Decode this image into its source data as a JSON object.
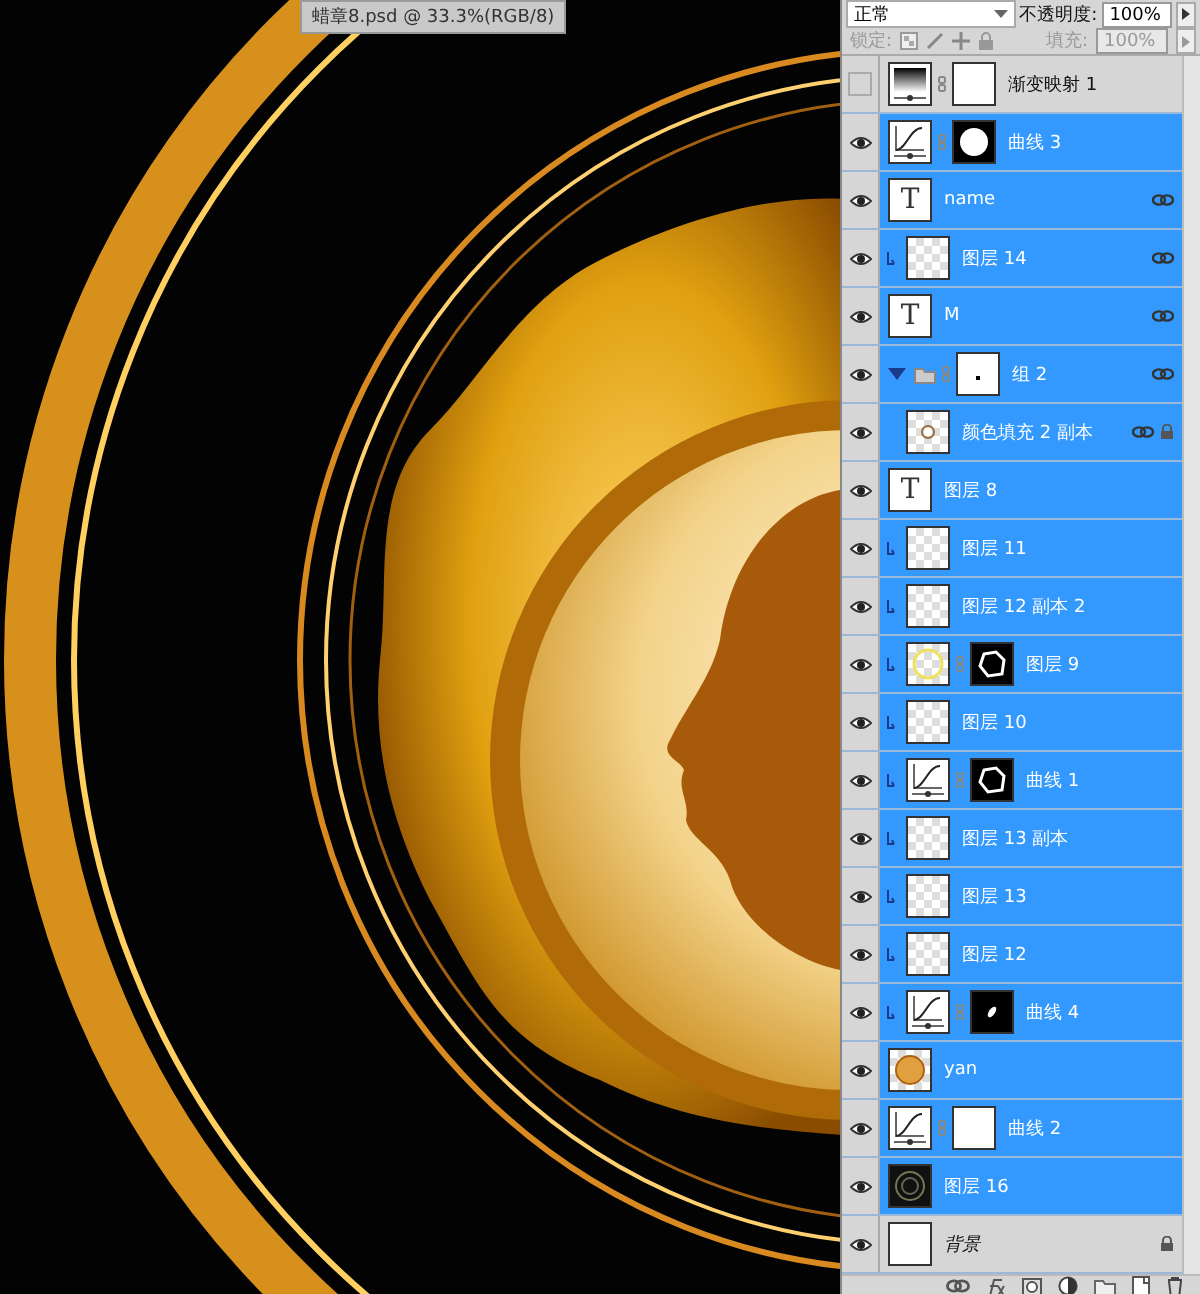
{
  "document_tab": {
    "title": "蜡章8.psd @ 33.3%(RGB/8)"
  },
  "layers_panel": {
    "blend_mode": "正常",
    "opacity_label": "不透明度:",
    "opacity": "100%",
    "lock_label": "锁定:",
    "fill_label": "填充:",
    "fill": "100%",
    "layers": [
      {
        "name": "渐变映射 1",
        "kind": "gradient",
        "visible": false,
        "selected": false,
        "clipped": false,
        "mask": {
          "kind": "plain"
        },
        "linked": false,
        "locked": false
      },
      {
        "name": "曲线 3",
        "kind": "curves",
        "visible": true,
        "selected": true,
        "clipped": false,
        "mask": {
          "kind": "circle"
        },
        "linked": false,
        "locked": false
      },
      {
        "name": "name",
        "kind": "text",
        "thumb_text": "T",
        "visible": true,
        "selected": true,
        "clipped": false,
        "linked": true,
        "locked": false
      },
      {
        "name": "图层 14",
        "kind": "pixel",
        "visible": true,
        "selected": true,
        "clipped": true,
        "linked": true,
        "locked": false
      },
      {
        "name": "M",
        "kind": "text",
        "thumb_text": "T",
        "visible": true,
        "selected": true,
        "clipped": false,
        "linked": true,
        "locked": false
      },
      {
        "name": "组 2",
        "kind": "group",
        "visible": true,
        "selected": true,
        "clipped": false,
        "mask": {
          "kind": "dot"
        },
        "linked": true,
        "locked": false,
        "expanded": true,
        "children": [
          {
            "name": "颜色填充 2 副本",
            "kind": "fill",
            "visible": true,
            "selected": true,
            "clipped": false,
            "linked": true,
            "locked": true
          }
        ]
      },
      {
        "name": "图层 8",
        "kind": "text",
        "thumb_text": "T",
        "visible": true,
        "selected": true,
        "clipped": false,
        "linked": false,
        "locked": false
      },
      {
        "name": "图层 11",
        "kind": "pixel",
        "visible": true,
        "selected": true,
        "clipped": true,
        "linked": false,
        "locked": false
      },
      {
        "name": "图层 12 副本 2",
        "kind": "pixel",
        "visible": true,
        "selected": true,
        "clipped": true,
        "linked": false,
        "locked": false
      },
      {
        "name": "图层 9",
        "kind": "ring",
        "visible": true,
        "selected": true,
        "clipped": true,
        "mask": {
          "kind": "outline"
        },
        "linked": false,
        "locked": false
      },
      {
        "name": "图层 10",
        "kind": "pixel",
        "visible": true,
        "selected": true,
        "clipped": true,
        "linked": false,
        "locked": false
      },
      {
        "name": "曲线 1",
        "kind": "curves",
        "visible": true,
        "selected": true,
        "clipped": true,
        "mask": {
          "kind": "outline"
        },
        "linked": false,
        "locked": false
      },
      {
        "name": "图层 13 副本",
        "kind": "pixel",
        "visible": true,
        "selected": true,
        "clipped": true,
        "linked": false,
        "locked": false
      },
      {
        "name": "图层 13",
        "kind": "pixel",
        "visible": true,
        "selected": true,
        "clipped": true,
        "linked": false,
        "locked": false
      },
      {
        "name": "图层 12",
        "kind": "pixel",
        "visible": true,
        "selected": true,
        "clipped": true,
        "linked": false,
        "locked": false
      },
      {
        "name": "曲线 4",
        "kind": "curves",
        "visible": true,
        "selected": true,
        "clipped": true,
        "mask": {
          "kind": "blob"
        },
        "linked": false,
        "locked": false
      },
      {
        "name": "yan",
        "kind": "seal",
        "visible": true,
        "selected": true,
        "clipped": false,
        "linked": false,
        "locked": false
      },
      {
        "name": "曲线 2",
        "kind": "curves",
        "visible": true,
        "selected": true,
        "clipped": false,
        "mask": {
          "kind": "plain"
        },
        "linked": false,
        "locked": false
      },
      {
        "name": "图层 16",
        "kind": "dark",
        "visible": true,
        "selected": true,
        "clipped": false,
        "linked": false,
        "locked": false
      },
      {
        "name": "背景",
        "kind": "background",
        "visible": true,
        "selected": false,
        "clipped": false,
        "linked": false,
        "locked": true
      }
    ]
  }
}
